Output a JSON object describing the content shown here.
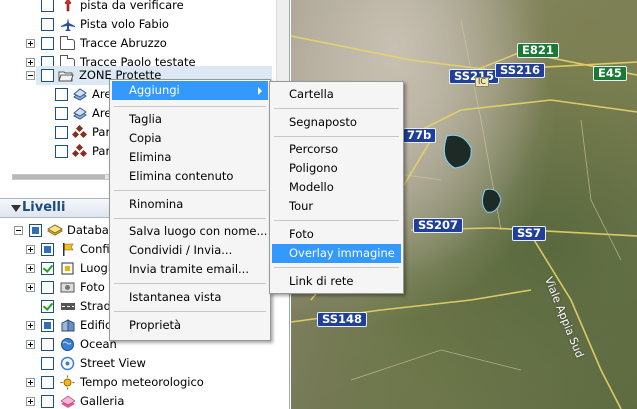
{
  "places_tree": {
    "items": [
      {
        "label": "pista da verificare",
        "icon": "pin-icon"
      },
      {
        "label": "Pista volo Fabio",
        "icon": "airplane-icon"
      },
      {
        "label": "Tracce Abruzzo",
        "icon": "folder-icon"
      },
      {
        "label": "Tracce Paolo testate",
        "icon": "folder-icon"
      },
      {
        "label": "ZONE Protette",
        "icon": "folder-open-icon"
      },
      {
        "label": "Are",
        "icon": "polygon-icon"
      },
      {
        "label": "Are",
        "icon": "polygon-icon"
      },
      {
        "label": "Par",
        "icon": "diamond-icon"
      },
      {
        "label": "Par",
        "icon": "diamond-icon"
      }
    ]
  },
  "layers": {
    "title": "Livelli",
    "items": [
      {
        "label": "Databas",
        "icon": "database-icon"
      },
      {
        "label": "Confi",
        "icon": "flag-icon"
      },
      {
        "label": "Luogh",
        "icon": "place-icon"
      },
      {
        "label": "Foto d",
        "icon": "photo-icon"
      },
      {
        "label": "Strade",
        "icon": "road-icon"
      },
      {
        "label": "Edific",
        "icon": "building-icon"
      },
      {
        "label": "Ocean",
        "icon": "ocean-icon"
      },
      {
        "label": "Street View",
        "icon": "street-view-icon"
      },
      {
        "label": "Tempo meteorologico",
        "icon": "weather-icon"
      },
      {
        "label": "Galleria",
        "icon": "gallery-icon"
      }
    ]
  },
  "context_menu": {
    "items": {
      "add": "Aggiungi",
      "cut": "Taglia",
      "copy": "Copia",
      "delete": "Elimina",
      "delete_contents": "Elimina contenuto",
      "rename": "Rinomina",
      "save_place_as": "Salva luogo con nome...",
      "share_send": "Condividi / Invia...",
      "send_email": "Invia tramite email...",
      "snapshot_view": "Istantanea vista",
      "properties": "Proprietà"
    }
  },
  "add_submenu": {
    "items": {
      "folder": "Cartella",
      "placemark": "Segnaposto",
      "path": "Percorso",
      "polygon": "Poligono",
      "model": "Modello",
      "tour": "Tour",
      "photo": "Foto",
      "image_overlay": "Overlay immagine",
      "network_link": "Link di rete"
    }
  },
  "map": {
    "labels": {
      "e821": "E821",
      "ss215": "SS215",
      "ss216": "SS216",
      "e45": "E45",
      "r77b": "77b",
      "ss207": "SS207",
      "ss7": "SS7",
      "ss148": "SS148",
      "ic": "IC",
      "road_name": "Viale Appia Sud"
    }
  },
  "colors": {
    "menu_highlight": "#3399ff",
    "route_shield": "#1f3f9a",
    "euro_shield": "#1a7a33"
  }
}
